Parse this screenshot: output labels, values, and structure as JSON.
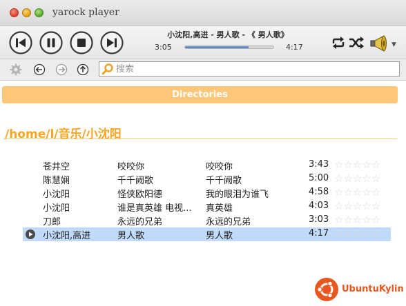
{
  "window": {
    "title": "yarock  player"
  },
  "player": {
    "track_title": "小沈阳,高进 - 男人歌 - 《 男人歌》",
    "elapsed": "3:05",
    "total": "4:17",
    "progress_fraction": 0.72,
    "icons": [
      "previous-icon",
      "pause-icon",
      "stop-icon",
      "next-icon",
      "repeat-icon",
      "shuffle-icon",
      "speaker-icon",
      "chevron-down-icon"
    ]
  },
  "toolbar": {
    "icons": [
      "settings-icon",
      "back-icon",
      "forward-icon",
      "up-icon",
      "search-icon"
    ],
    "search_placeholder": "搜索"
  },
  "browser": {
    "section_header": "Directories",
    "path": "/home/l/音乐/小沈阳"
  },
  "tracks": [
    {
      "artist": "苍井空",
      "album": "咬咬你",
      "title": "咬咬你",
      "duration": "3:43",
      "rating": 0,
      "current": false
    },
    {
      "artist": "陈慧娴",
      "album": "千千阙歌",
      "title": "千千阙歌",
      "duration": "5:00",
      "rating": 0,
      "current": false
    },
    {
      "artist": "小沈阳",
      "album": "怪侠欧阳德",
      "title": "我的眼泪为谁飞",
      "duration": "4:58",
      "rating": 0,
      "current": false
    },
    {
      "artist": "小沈阳",
      "album": "谁是真英雄 电视...",
      "title": "真英雄",
      "duration": "4:03",
      "rating": 0,
      "current": false
    },
    {
      "artist": "刀郎",
      "album": "永远的兄弟",
      "title": "永远的兄弟",
      "duration": "3:03",
      "rating": 0,
      "current": false
    },
    {
      "artist": "小沈阳,高进",
      "album": "男人歌",
      "title": "男人歌",
      "duration": "4:17",
      "rating": 0,
      "current": true
    }
  ],
  "branding": {
    "logo_text": "UbuntuKylin",
    "accent": "#e8571e"
  },
  "colors": {
    "header_orange": "#fdc77a",
    "path_orange": "#f6a623",
    "selection_blue": "#c0dafa"
  }
}
